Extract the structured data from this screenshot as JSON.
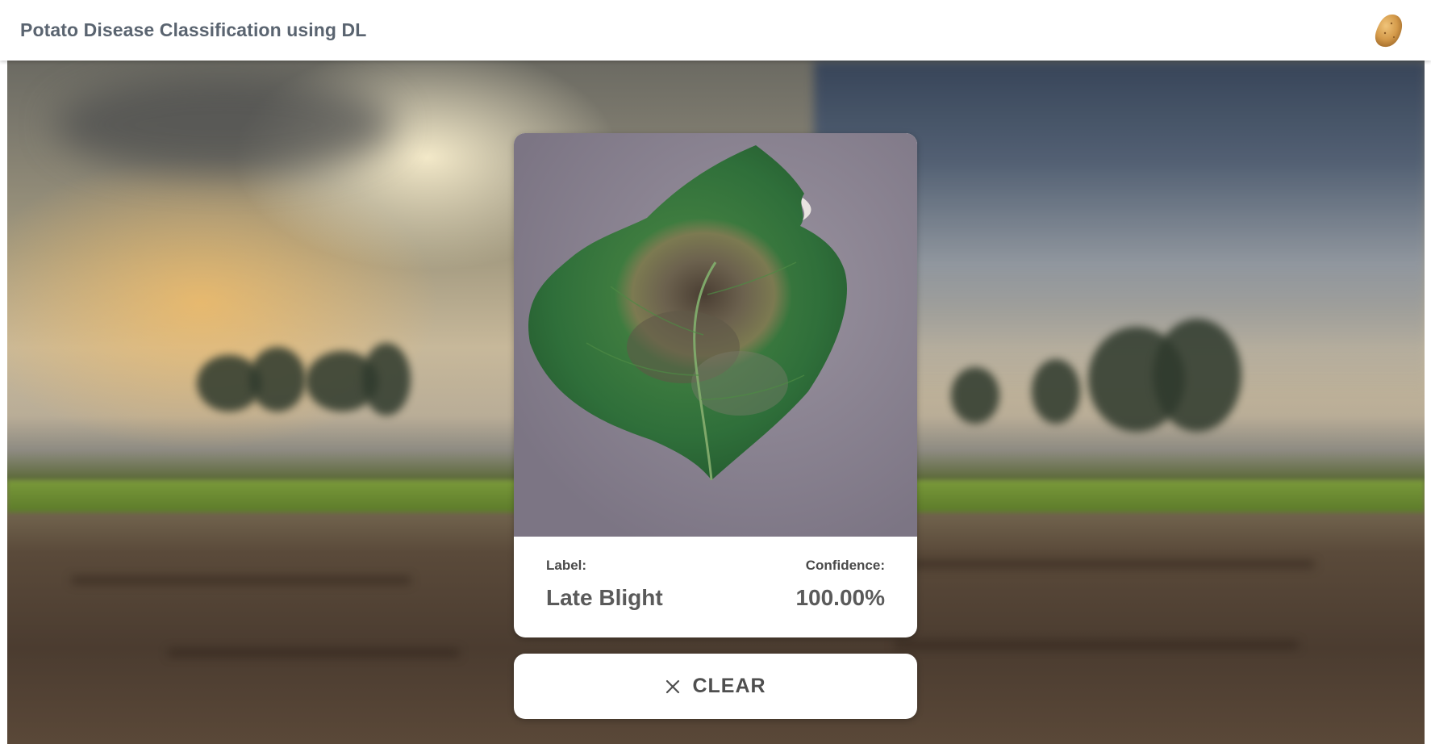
{
  "header": {
    "title": "Potato Disease Classification using DL",
    "logo_icon": "potato-icon"
  },
  "result": {
    "label_caption": "Label:",
    "label_value": "Late Blight",
    "confidence_caption": "Confidence:",
    "confidence_value": "100.00%"
  },
  "actions": {
    "clear_label": "CLEAR",
    "clear_icon": "close-icon"
  },
  "colors": {
    "leaf": "#2f6f3a",
    "title_text": "#5a6470",
    "potato": "#d49a4a"
  }
}
